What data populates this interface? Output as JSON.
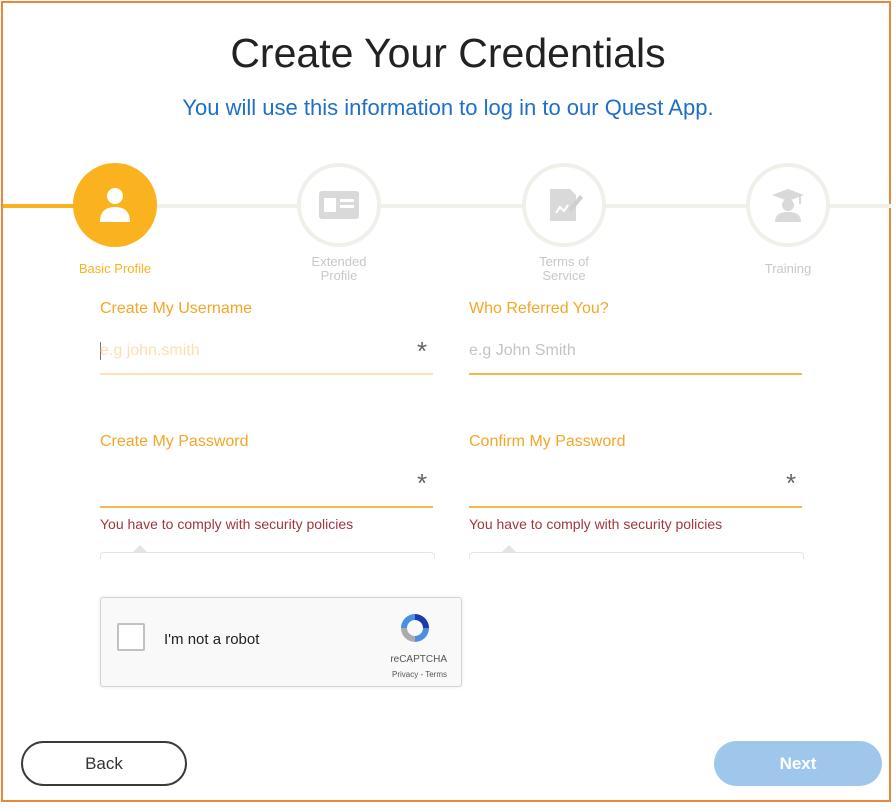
{
  "header": {
    "title": "Create Your Credentials",
    "subtitle": "You will use this information to log in to our Quest App."
  },
  "steps": [
    {
      "label": "Basic Profile",
      "icon": "user-icon",
      "state": "active"
    },
    {
      "label": "Extended Profile",
      "icon": "id-card-icon",
      "state": "inactive"
    },
    {
      "label": "Terms of Service",
      "icon": "document-sign-icon",
      "state": "inactive"
    },
    {
      "label": "Training",
      "icon": "graduation-cap-icon",
      "state": "inactive"
    }
  ],
  "form": {
    "username": {
      "label": "Create My Username",
      "placeholder": "e.g john.smith",
      "required_mark": "*"
    },
    "referrer": {
      "label": "Who Referred You?",
      "placeholder": "e.g John Smith"
    },
    "password": {
      "label": "Create My Password",
      "required_mark": "*",
      "error": "You have to comply with security policies"
    },
    "confirm_password": {
      "label": "Confirm My Password",
      "required_mark": "*",
      "error": "You have to comply with security policies"
    }
  },
  "captcha": {
    "label": "I'm not a robot",
    "brand": "reCAPTCHA",
    "links": "Privacy - Terms"
  },
  "nav": {
    "back_label": "Back",
    "next_label": "Next"
  },
  "colors": {
    "accent": "#fbb21f",
    "link_blue": "#1f6fc7",
    "frame_border": "#e8893a",
    "next_button": "#9fc7ec",
    "error": "#a0383a"
  }
}
